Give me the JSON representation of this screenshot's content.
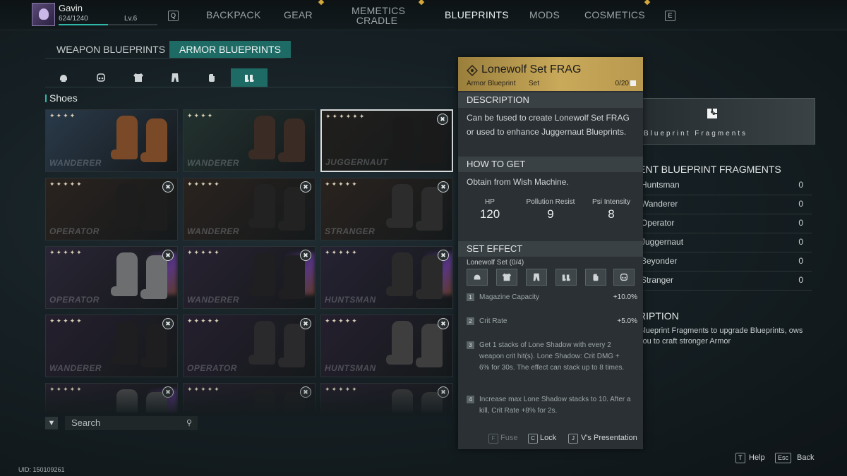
{
  "player": {
    "name": "Gavin",
    "xp": "624/1240",
    "level": "Lv.6",
    "xp_fraction": 0.503
  },
  "nav": {
    "left_key": "Q",
    "right_key": "E",
    "tabs": [
      {
        "label": "BACKPACK"
      },
      {
        "label": "GEAR"
      },
      {
        "label_line1": "MEMETICS",
        "label_line2": "CRADLE"
      },
      {
        "label": "BLUEPRINTS"
      },
      {
        "label": "MODS"
      },
      {
        "label": "COSMETICS"
      }
    ],
    "active": "BLUEPRINTS"
  },
  "subtabs": [
    "WEAPON BLUEPRINTS",
    "ARMOR BLUEPRINTS"
  ],
  "categories": [
    "helmet-icon",
    "mask-icon",
    "chest-icon",
    "pants-icon",
    "gloves-icon",
    "shoes-icon"
  ],
  "section_title": "Shoes",
  "grid": [
    {
      "stars": "✦✦✦✦",
      "brand": "WANDERER",
      "lock": false,
      "bg": "#2a3a4a",
      "boot": "#7a4a28",
      "selected": false,
      "rainbow": false
    },
    {
      "stars": "✦✦✦✦",
      "brand": "WANDERER",
      "lock": false,
      "bg": "#22322f",
      "boot": "#3a2b25",
      "selected": false,
      "rainbow": false
    },
    {
      "stars": "✦✦✦✦✦✦",
      "brand": "JUGGERNAUT",
      "lock": true,
      "bg": "#211f1c",
      "boot": "#1a1a1a",
      "selected": true,
      "rainbow": false
    },
    {
      "stars": "✦✦✦✦✦",
      "brand": "OPERATOR",
      "lock": true,
      "bg": "#2a231f",
      "boot": "#1d1d1e",
      "selected": false,
      "rainbow": false
    },
    {
      "stars": "✦✦✦✦✦",
      "brand": "WANDERER",
      "lock": true,
      "bg": "#2a231f",
      "boot": "#232222",
      "selected": false,
      "rainbow": false
    },
    {
      "stars": "✦✦✦✦✦",
      "brand": "STRANGER",
      "lock": true,
      "bg": "#2a231f",
      "boot": "#2c2c2c",
      "selected": false,
      "rainbow": false
    },
    {
      "stars": "✦✦✦✦✦",
      "brand": "OPERATOR",
      "lock": true,
      "bg": "#2a2535",
      "boot": "#6c6e70",
      "selected": false,
      "rainbow": true
    },
    {
      "stars": "✦✦✦✦✦",
      "brand": "WANDERER",
      "lock": true,
      "bg": "#282232",
      "boot": "#1f1f21",
      "selected": false,
      "rainbow": true
    },
    {
      "stars": "✦✦✦✦✦",
      "brand": "HUNTSMAN",
      "lock": true,
      "bg": "#262233",
      "boot": "#2a2a2b",
      "selected": false,
      "rainbow": true
    },
    {
      "stars": "✦✦✦✦✦",
      "brand": "WANDERER",
      "lock": true,
      "bg": "#251f2e",
      "boot": "#1e1e20",
      "selected": false,
      "rainbow": false
    },
    {
      "stars": "✦✦✦✦✦",
      "brand": "OPERATOR",
      "lock": true,
      "bg": "#251f2e",
      "boot": "#2a2a2c",
      "selected": false,
      "rainbow": false
    },
    {
      "stars": "✦✦✦✦✦",
      "brand": "HUNTSMAN",
      "lock": true,
      "bg": "#251f2e",
      "boot": "#3e3e3e",
      "selected": false,
      "rainbow": false
    },
    {
      "stars": "✦✦✦✦✦",
      "brand": "",
      "lock": true,
      "bg": "#24202c",
      "boot": "#4a4a4c",
      "selected": false,
      "rainbow": true
    },
    {
      "stars": "✦✦✦✦✦",
      "brand": "",
      "lock": true,
      "bg": "#24202c",
      "boot": "#1f1f21",
      "selected": false,
      "rainbow": false
    },
    {
      "stars": "✦✦✦✦✦",
      "brand": "",
      "lock": true,
      "bg": "#24202c",
      "boot": "#3a3a3c",
      "selected": false,
      "rainbow": false
    }
  ],
  "search": {
    "placeholder": "Search"
  },
  "tooltip": {
    "title": "Lonewolf Set FRAG",
    "type": "Armor Blueprint",
    "subtype": "Set",
    "count": "0/20",
    "description_title": "DESCRIPTION",
    "description": "Can be fused to create Lonewolf Set FRAG or used to enhance Juggernaut Blueprints.",
    "how_title": "HOW TO GET",
    "how": "Obtain from Wish Machine.",
    "stats": [
      {
        "label": "HP",
        "value": "120"
      },
      {
        "label": "Pollution Resist",
        "value": "9"
      },
      {
        "label": "Psi Intensity",
        "value": "8"
      }
    ],
    "set_title": "SET EFFECT",
    "set_name": "Lonewolf Set (0/4)",
    "set_pieces": [
      "helmet-icon",
      "chest-icon",
      "pants-icon",
      "shoes-icon",
      "gloves-icon",
      "mask-icon"
    ],
    "effects": [
      {
        "num": "1",
        "text": "Magazine Capacity",
        "value": "+10.0%"
      },
      {
        "num": "2",
        "text": "Crit Rate",
        "value": "+5.0%"
      },
      {
        "num": "3",
        "text": "Get 1 stacks of Lone Shadow with every 2 weapon crit hit(s). Lone Shadow: Crit DMG + 6% for 30s. The effect can stack up to 8 times.",
        "value": ""
      },
      {
        "num": "4",
        "text": "Increase max Lone Shadow stacks to 10. After a kill, Crit Rate +8% for 2s.",
        "value": ""
      }
    ],
    "footer": [
      {
        "key": "F",
        "label": "Fuse"
      },
      {
        "key": "C",
        "label": "Lock"
      },
      {
        "key": "J",
        "label": "V's Presentation"
      }
    ]
  },
  "right_panel": {
    "fragment_label": "Blueprint Fragments",
    "title": "ENT BLUEPRINT FRAGMENTS",
    "rows": [
      {
        "name": "Huntsman",
        "count": "0"
      },
      {
        "name": "Wanderer",
        "count": "0"
      },
      {
        "name": "Operator",
        "count": "0"
      },
      {
        "name": "Juggernaut",
        "count": "0"
      },
      {
        "name": "Beyonder",
        "count": "0"
      },
      {
        "name": "Stranger",
        "count": "0"
      }
    ],
    "desc_title": "RIPTION",
    "desc": "Blueprint Fragments to upgrade Blueprints, ows you to craft stronger Armor"
  },
  "footer": {
    "uid": "UID: 150109261",
    "help_key": "T",
    "help_label": "Help",
    "back_key": "Esc",
    "back_label": "Back"
  }
}
